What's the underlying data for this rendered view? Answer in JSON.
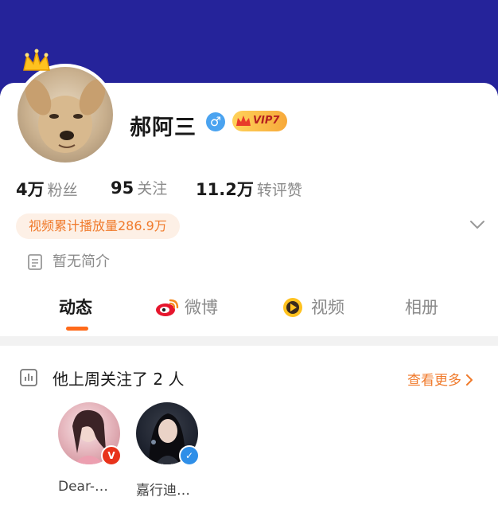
{
  "colors": {
    "banner": "#25239a",
    "accent": "#f07a2b",
    "vip_gold": "#f7a93a",
    "tab_indicator": "#ff6a1a",
    "gender_blue": "#4aa3f0",
    "verified_red": "#e8331b",
    "verified_blue": "#2f8fe8"
  },
  "profile": {
    "name": "郝阿三",
    "gender_symbol": "♂",
    "vip_label": "VIP7",
    "avatar_icon": "dog-avatar-icon",
    "crown_icon": "crown-icon"
  },
  "stats": [
    {
      "num": "4万",
      "label": "粉丝"
    },
    {
      "num": "95",
      "label": "关注"
    },
    {
      "num": "11.2万",
      "label": "转评赞"
    }
  ],
  "views_badge": "视频累计播放量286.9万",
  "bio": "暂无简介",
  "tabs": [
    {
      "label": "动态",
      "icon": ""
    },
    {
      "label": "微博",
      "icon": "weibo-icon"
    },
    {
      "label": "视频",
      "icon": "video-play-icon"
    },
    {
      "label": "相册",
      "icon": ""
    }
  ],
  "follow_section": {
    "title": "他上周关注了 2 人",
    "more": "查看更多",
    "users": [
      {
        "name": "Dear-…",
        "badge": "V",
        "badge_color": "#e8331b"
      },
      {
        "name": "嘉行迪…",
        "badge": "✓",
        "badge_color": "#2f8fe8"
      }
    ]
  }
}
